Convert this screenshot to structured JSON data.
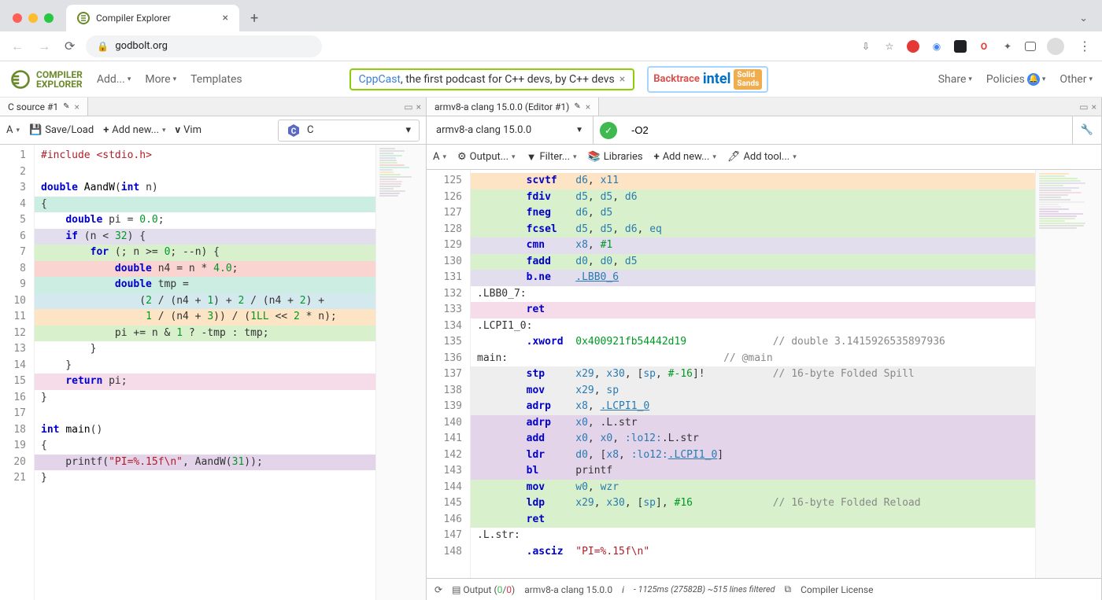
{
  "browser": {
    "tab_title": "Compiler Explorer",
    "url": "godbolt.org",
    "new_tab_icon": "+",
    "extensions": [
      "share",
      "star",
      "rec",
      "globe",
      "term",
      "opera",
      "puzzle",
      "panel"
    ]
  },
  "app_header": {
    "logo_top": "COMPILER",
    "logo_bottom": "EXPLORER",
    "menu": {
      "add": "Add...",
      "more": "More",
      "templates": "Templates",
      "share": "Share",
      "policies": "Policies",
      "other": "Other"
    },
    "sponsor_link_text": "CppCast",
    "sponsor_rest": ", the first podcast for C++ devs, by C++ devs",
    "sponsor_logos": [
      "Backtrace",
      "intel",
      "Solid Sands"
    ]
  },
  "left": {
    "tab_label": "C source #1",
    "toolbar": {
      "font": "A",
      "save": "Save/Load",
      "add_new": "Add new...",
      "vim": "Vim"
    },
    "language": "C",
    "lines": [
      {
        "n": 1,
        "bg": "",
        "html": "<span class='pp'>#include</span> <span class='str'>&lt;stdio.h&gt;</span>"
      },
      {
        "n": 2,
        "bg": "",
        "html": ""
      },
      {
        "n": 3,
        "bg": "",
        "html": "<span class='ty'>double</span> <span class='fn'>AandW</span>(<span class='ty'>int</span> n)"
      },
      {
        "n": 4,
        "bg": "bg-mint",
        "html": "{"
      },
      {
        "n": 5,
        "bg": "",
        "html": "    <span class='ty'>double</span> pi = <span class='num'>0.0</span>;"
      },
      {
        "n": 6,
        "bg": "bg-lilac",
        "html": "    <span class='kw'>if</span> (n &lt; <span class='num'>32</span>) {"
      },
      {
        "n": 7,
        "bg": "bg-green",
        "html": "        <span class='kw'>for</span> (; n &gt;= <span class='num'>0</span>; --n) {"
      },
      {
        "n": 8,
        "bg": "bg-red",
        "html": "            <span class='ty'>double</span> n4 = n * <span class='num'>4.0</span>;"
      },
      {
        "n": 9,
        "bg": "bg-mint",
        "html": "            <span class='ty'>double</span> tmp ="
      },
      {
        "n": 10,
        "bg": "bg-cyan",
        "html": "                (<span class='num'>2</span> / (n4 + <span class='num'>1</span>) + <span class='num'>2</span> / (n4 + <span class='num'>2</span>) +"
      },
      {
        "n": 11,
        "bg": "bg-orange",
        "html": "                 <span class='num'>1</span> / (n4 + <span class='num'>3</span>)) / (<span class='num'>1LL</span> &lt;&lt; <span class='num'>2</span> * n);"
      },
      {
        "n": 12,
        "bg": "bg-green",
        "html": "            pi += n &amp; <span class='num'>1</span> ? -tmp : tmp;"
      },
      {
        "n": 13,
        "bg": "",
        "html": "        }"
      },
      {
        "n": 14,
        "bg": "",
        "html": "    }"
      },
      {
        "n": 15,
        "bg": "bg-pink",
        "html": "    <span class='kw'>return</span> pi;"
      },
      {
        "n": 16,
        "bg": "",
        "html": "}"
      },
      {
        "n": 17,
        "bg": "",
        "html": ""
      },
      {
        "n": 18,
        "bg": "",
        "html": "<span class='ty'>int</span> <span class='fn'>main</span>()"
      },
      {
        "n": 19,
        "bg": "",
        "html": "{"
      },
      {
        "n": 20,
        "bg": "bg-purple",
        "html": "    printf(<span class='str'>\"PI=%.15f\\n\"</span>, AandW(<span class='num'>31</span>));"
      },
      {
        "n": 21,
        "bg": "",
        "html": "}"
      }
    ]
  },
  "right": {
    "tab_label": "armv8-a clang 15.0.0 (Editor #1)",
    "compiler": "armv8-a clang 15.0.0",
    "flags": "-O2",
    "toolbar2": {
      "font": "A",
      "output": "Output...",
      "filter": "Filter...",
      "libraries": "Libraries",
      "add_new": "Add new...",
      "add_tool": "Add tool..."
    },
    "lines": [
      {
        "n": 125,
        "bg": "bg-orange",
        "html": "        <span class='ins'>scvtf</span>   <span class='reg'>d6</span>, <span class='reg'>x11</span>"
      },
      {
        "n": 126,
        "bg": "bg-green",
        "html": "        <span class='ins'>fdiv</span>    <span class='reg'>d5</span>, <span class='reg'>d5</span>, <span class='reg'>d6</span>"
      },
      {
        "n": 127,
        "bg": "bg-green",
        "html": "        <span class='ins'>fneg</span>    <span class='reg'>d6</span>, <span class='reg'>d5</span>"
      },
      {
        "n": 128,
        "bg": "bg-green",
        "html": "        <span class='ins'>fcsel</span>   <span class='reg'>d5</span>, <span class='reg'>d5</span>, <span class='reg'>d6</span>, <span class='reg'>eq</span>"
      },
      {
        "n": 129,
        "bg": "bg-lilac",
        "html": "        <span class='ins'>cmn</span>     <span class='reg'>x8</span>, <span class='num'>#1</span>"
      },
      {
        "n": 130,
        "bg": "bg-green",
        "html": "        <span class='ins'>fadd</span>    <span class='reg'>d0</span>, <span class='reg'>d0</span>, <span class='reg'>d5</span>"
      },
      {
        "n": 131,
        "bg": "bg-lilac",
        "html": "        <span class='ins'>b.ne</span>    <span class='ref'>.LBB0_6</span>"
      },
      {
        "n": 132,
        "bg": "",
        "html": "<span class='lbl'>.LBB0_7:</span>"
      },
      {
        "n": 133,
        "bg": "bg-pink",
        "html": "        <span class='ins'>ret</span>"
      },
      {
        "n": 134,
        "bg": "",
        "html": "<span class='lbl'>.LCPI1_0:</span>"
      },
      {
        "n": 135,
        "bg": "",
        "html": "        <span class='ins'>.xword</span>  <span class='num'>0x400921fb54442d19</span>              <span class='cmt'>// double 3.1415926535897936</span>"
      },
      {
        "n": 136,
        "bg": "",
        "html": "<span class='lbl'>main:</span>                                   <span class='cmt'>// @main</span>"
      },
      {
        "n": 137,
        "bg": "bg-gray",
        "html": "        <span class='ins'>stp</span>     <span class='reg'>x29</span>, <span class='reg'>x30</span>, [<span class='reg'>sp</span>, <span class='num'>#-16</span>]!           <span class='cmt'>// 16-byte Folded Spill</span>"
      },
      {
        "n": 138,
        "bg": "bg-gray",
        "html": "        <span class='ins'>mov</span>     <span class='reg'>x29</span>, <span class='reg'>sp</span>"
      },
      {
        "n": 139,
        "bg": "bg-gray",
        "html": "        <span class='ins'>adrp</span>    <span class='reg'>x8</span>, <span class='ref'>.LCPI1_0</span>"
      },
      {
        "n": 140,
        "bg": "bg-purple",
        "html": "        <span class='ins'>adrp</span>    <span class='reg'>x0</span>, .L.str"
      },
      {
        "n": 141,
        "bg": "bg-purple",
        "html": "        <span class='ins'>add</span>     <span class='reg'>x0</span>, <span class='reg'>x0</span>, <span class='reg'>:lo12:</span>.L.str"
      },
      {
        "n": 142,
        "bg": "bg-purple",
        "html": "        <span class='ins'>ldr</span>     <span class='reg'>d0</span>, [<span class='reg'>x8</span>, <span class='reg'>:lo12:</span><span class='ref'>.LCPI1_0</span>]"
      },
      {
        "n": 143,
        "bg": "bg-purple",
        "html": "        <span class='ins'>bl</span>      printf"
      },
      {
        "n": 144,
        "bg": "bg-green",
        "html": "        <span class='ins'>mov</span>     <span class='reg'>w0</span>, <span class='reg'>wzr</span>"
      },
      {
        "n": 145,
        "bg": "bg-green",
        "html": "        <span class='ins'>ldp</span>     <span class='reg'>x29</span>, <span class='reg'>x30</span>, [<span class='reg'>sp</span>], <span class='num'>#16</span>             <span class='cmt'>// 16-byte Folded Reload</span>"
      },
      {
        "n": 146,
        "bg": "bg-green",
        "html": "        <span class='ins'>ret</span>"
      },
      {
        "n": 147,
        "bg": "",
        "html": "<span class='lbl'>.L.str:</span>"
      },
      {
        "n": 148,
        "bg": "",
        "html": "        <span class='ins'>.asciz</span>  <span class='str'>\"PI=%.15f\\n\"</span>"
      }
    ],
    "bottom": {
      "output_label": "Output",
      "out_pass": "0",
      "out_fail": "0",
      "compiler": "armv8-a clang 15.0.0",
      "stats": "- 1125ms (27582B) ~515 lines filtered",
      "license": "Compiler License"
    }
  }
}
